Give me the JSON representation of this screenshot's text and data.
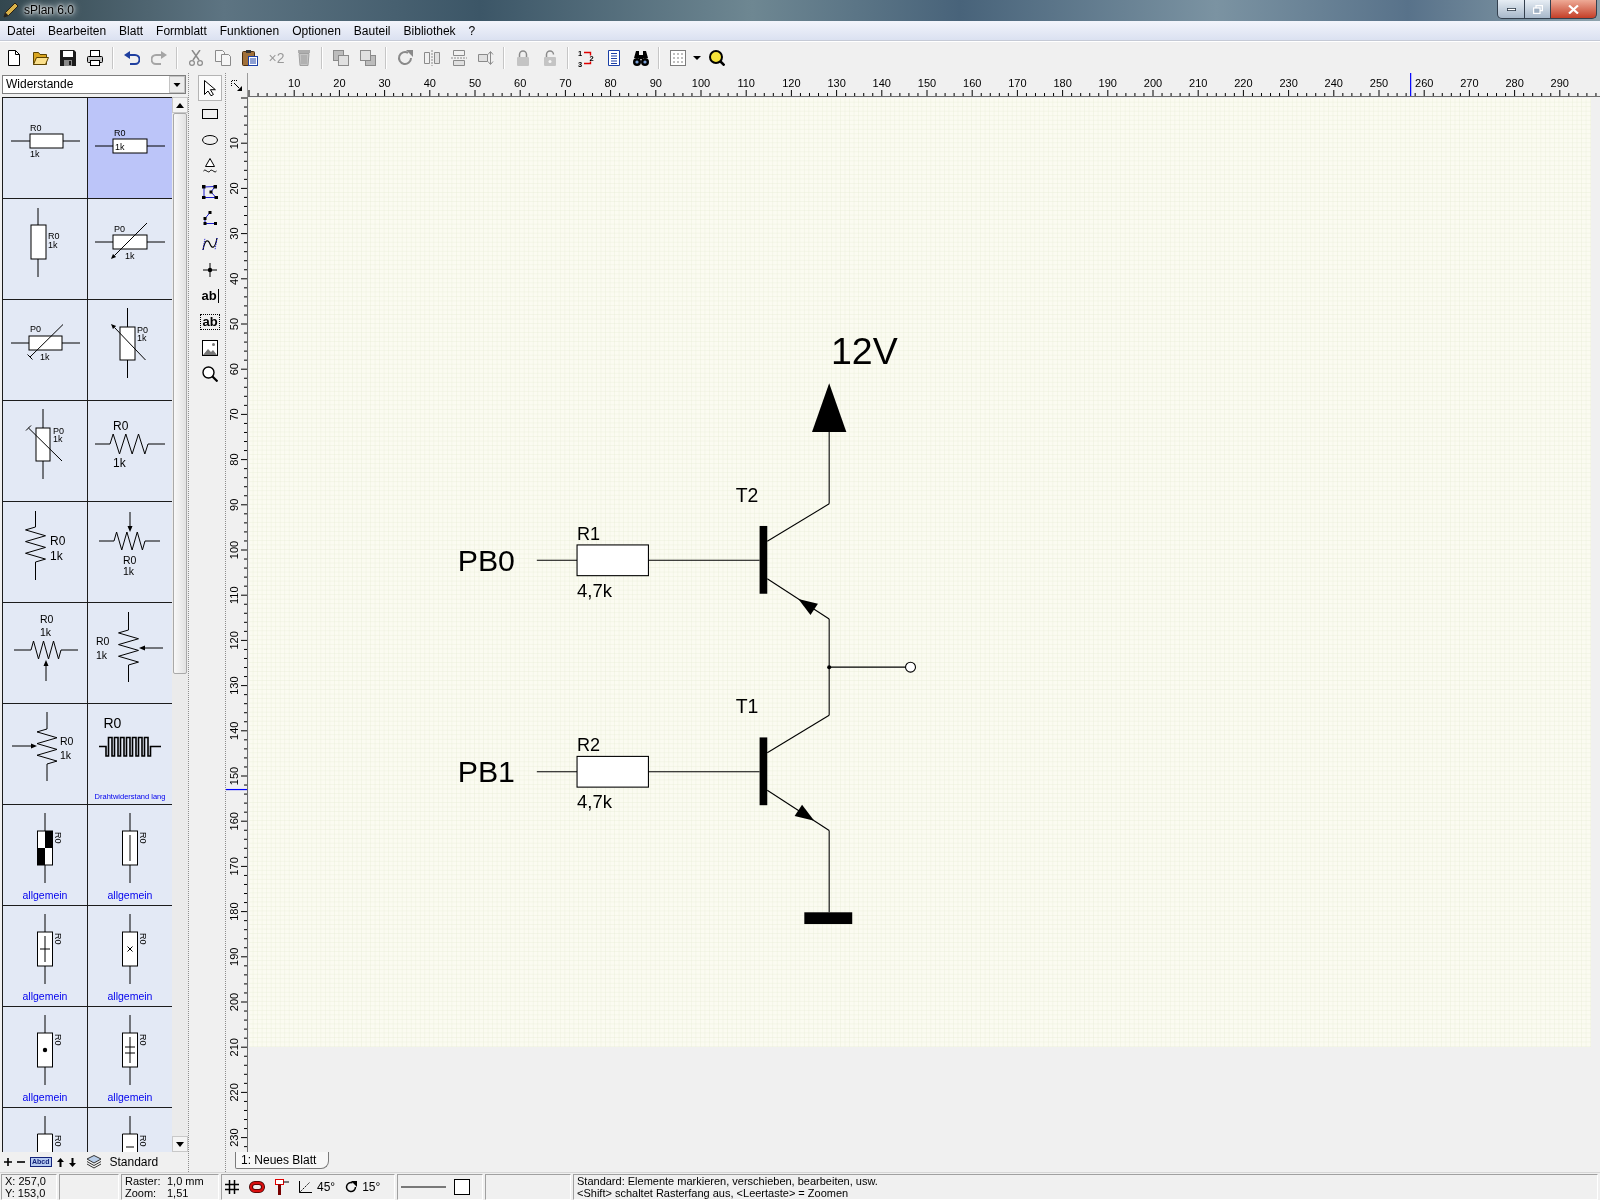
{
  "window": {
    "title": "sPlan 6.0"
  },
  "menu": [
    "Datei",
    "Bearbeiten",
    "Blatt",
    "Formblatt",
    "Funktionen",
    "Optionen",
    "Bauteil",
    "Bibliothek",
    "?"
  ],
  "toolbar": {
    "groups": [
      [
        {
          "disabled": false
        },
        {
          "disabled": false
        },
        {
          "disabled": false
        },
        {
          "disabled": false
        }
      ],
      [
        {
          "disabled": false
        },
        {
          "disabled": true
        }
      ],
      [
        {
          "disabled": true
        },
        {
          "disabled": true
        },
        {
          "disabled": false
        },
        {
          "label": "×2",
          "disabled": true
        },
        {
          "disabled": true
        }
      ],
      [
        {
          "disabled": true
        },
        {
          "disabled": true
        }
      ],
      [
        {
          "disabled": true
        },
        {
          "disabled": true
        },
        {
          "disabled": true
        },
        {
          "disabled": true
        }
      ],
      [
        {
          "disabled": true
        },
        {
          "disabled": true
        }
      ],
      [
        {
          "labels": [
            "1",
            "2",
            "3"
          ],
          "disabled": false
        },
        {
          "disabled": false
        },
        {
          "disabled": false
        }
      ],
      [
        {
          "disabled": false
        },
        {
          "disabled": false
        },
        {
          "disabled": false
        }
      ]
    ]
  },
  "library": {
    "category": "Widerstande",
    "items": [
      {
        "kind": "box_h",
        "labels": [
          "R0",
          "1k"
        ],
        "selected": false
      },
      {
        "kind": "box_h_inner",
        "labels": [
          "R0",
          "1k"
        ],
        "selected": true
      },
      {
        "kind": "box_v",
        "labels": [
          "R0",
          "1k"
        ],
        "selected": false
      },
      {
        "kind": "var_h",
        "labels": [
          "P0",
          "1k"
        ],
        "selected": false
      },
      {
        "kind": "trim_h",
        "labels": [
          "P0",
          "1k"
        ],
        "selected": false
      },
      {
        "kind": "var_v",
        "labels": [
          "P0",
          "1k"
        ],
        "selected": false
      },
      {
        "kind": "trim_v",
        "labels": [
          "P0",
          "1k"
        ],
        "selected": false
      },
      {
        "kind": "zigzag_h",
        "labels": [
          "R0",
          "1k"
        ],
        "selected": false
      },
      {
        "kind": "zigzag_v",
        "labels": [
          "R0",
          "1k"
        ],
        "selected": false
      },
      {
        "kind": "pot_top",
        "labels": [
          "R0",
          "1k"
        ],
        "selected": false
      },
      {
        "kind": "pot_bottom",
        "labels": [
          "R0",
          "1k"
        ],
        "selected": false
      },
      {
        "kind": "pot_right",
        "labels": [
          "R0",
          "1k"
        ],
        "selected": false
      },
      {
        "kind": "pot_left",
        "labels": [
          "R0",
          "1k"
        ],
        "selected": false
      },
      {
        "kind": "wirewound",
        "labels": [
          "R0"
        ],
        "caption": "Drahtwiderstand lang",
        "selected": false
      },
      {
        "kind": "box_half",
        "labels": [
          "R0"
        ],
        "caption": "allgemein",
        "selected": false
      },
      {
        "kind": "box_line",
        "labels": [
          "R0"
        ],
        "caption": "allgemein",
        "selected": false
      },
      {
        "kind": "box_plus",
        "labels": [
          "R0"
        ],
        "caption": "allgemein",
        "selected": false
      },
      {
        "kind": "box_x",
        "labels": [
          "R0"
        ],
        "caption": "allgemein",
        "selected": false
      },
      {
        "kind": "box_dot",
        "labels": [
          "R0"
        ],
        "caption": "allgemein",
        "selected": false
      },
      {
        "kind": "box_dplus",
        "labels": [
          "R0"
        ],
        "caption": "allgemein",
        "selected": false
      },
      {
        "kind": "box_plain",
        "labels": [
          "R0"
        ],
        "selected": false
      },
      {
        "kind": "box_bar",
        "labels": [
          "R0"
        ],
        "selected": false
      }
    ],
    "footer": {
      "button_label": "Abcd",
      "library_name": "Standard"
    }
  },
  "tools": [
    {
      "selected": true
    },
    {
      "selected": false
    },
    {
      "selected": false
    },
    {
      "selected": false
    },
    {
      "selected": false
    },
    {
      "selected": false
    },
    {
      "selected": false
    },
    {
      "selected": false
    },
    {
      "label": "ab",
      "selected": false
    },
    {
      "label": "ab",
      "selected": false
    },
    {
      "selected": false
    },
    {
      "selected": false
    }
  ],
  "rulers": {
    "horizontal": [
      "10",
      "20",
      "30",
      "40",
      "50",
      "60",
      "70",
      "80",
      "90",
      "100",
      "110",
      "120",
      "130",
      "140",
      "150",
      "160",
      "170",
      "180",
      "190",
      "200",
      "210",
      "220",
      "230",
      "240",
      "250",
      "260",
      "270",
      "280",
      "290"
    ],
    "vertical": [
      "10",
      "20",
      "30",
      "40",
      "50",
      "60",
      "70",
      "80",
      "90",
      "100",
      "110",
      "120",
      "130",
      "140",
      "150",
      "160",
      "170",
      "180",
      "190",
      "200",
      "210",
      "220",
      "230"
    ]
  },
  "schematic": {
    "supply_label": "12V",
    "stages": [
      {
        "input_label": "PB0",
        "resistor": {
          "name": "R1",
          "value": "4,7k"
        },
        "transistor": {
          "name": "T2",
          "kind": "pnp"
        }
      },
      {
        "input_label": "PB1",
        "resistor": {
          "name": "R2",
          "value": "4,7k"
        },
        "transistor": {
          "name": "T1",
          "kind": "npn"
        }
      }
    ]
  },
  "sheet_tabs": [
    {
      "label": "1: Neues Blatt",
      "selected": true
    }
  ],
  "status_bar": {
    "x": "X: 257,0",
    "y": "Y: 153,0",
    "raster": {
      "label": "Raster:",
      "value": "1,0 mm"
    },
    "zoom": {
      "label": "Zoom:",
      "value": "1,51"
    },
    "angle": "45°",
    "rotation": "15°",
    "message": [
      "Standard: Elemente markieren, verschieben, bearbeiten, usw.",
      "<Shift> schaltet Rasterfang aus, <Leertaste> = Zoomen"
    ]
  }
}
